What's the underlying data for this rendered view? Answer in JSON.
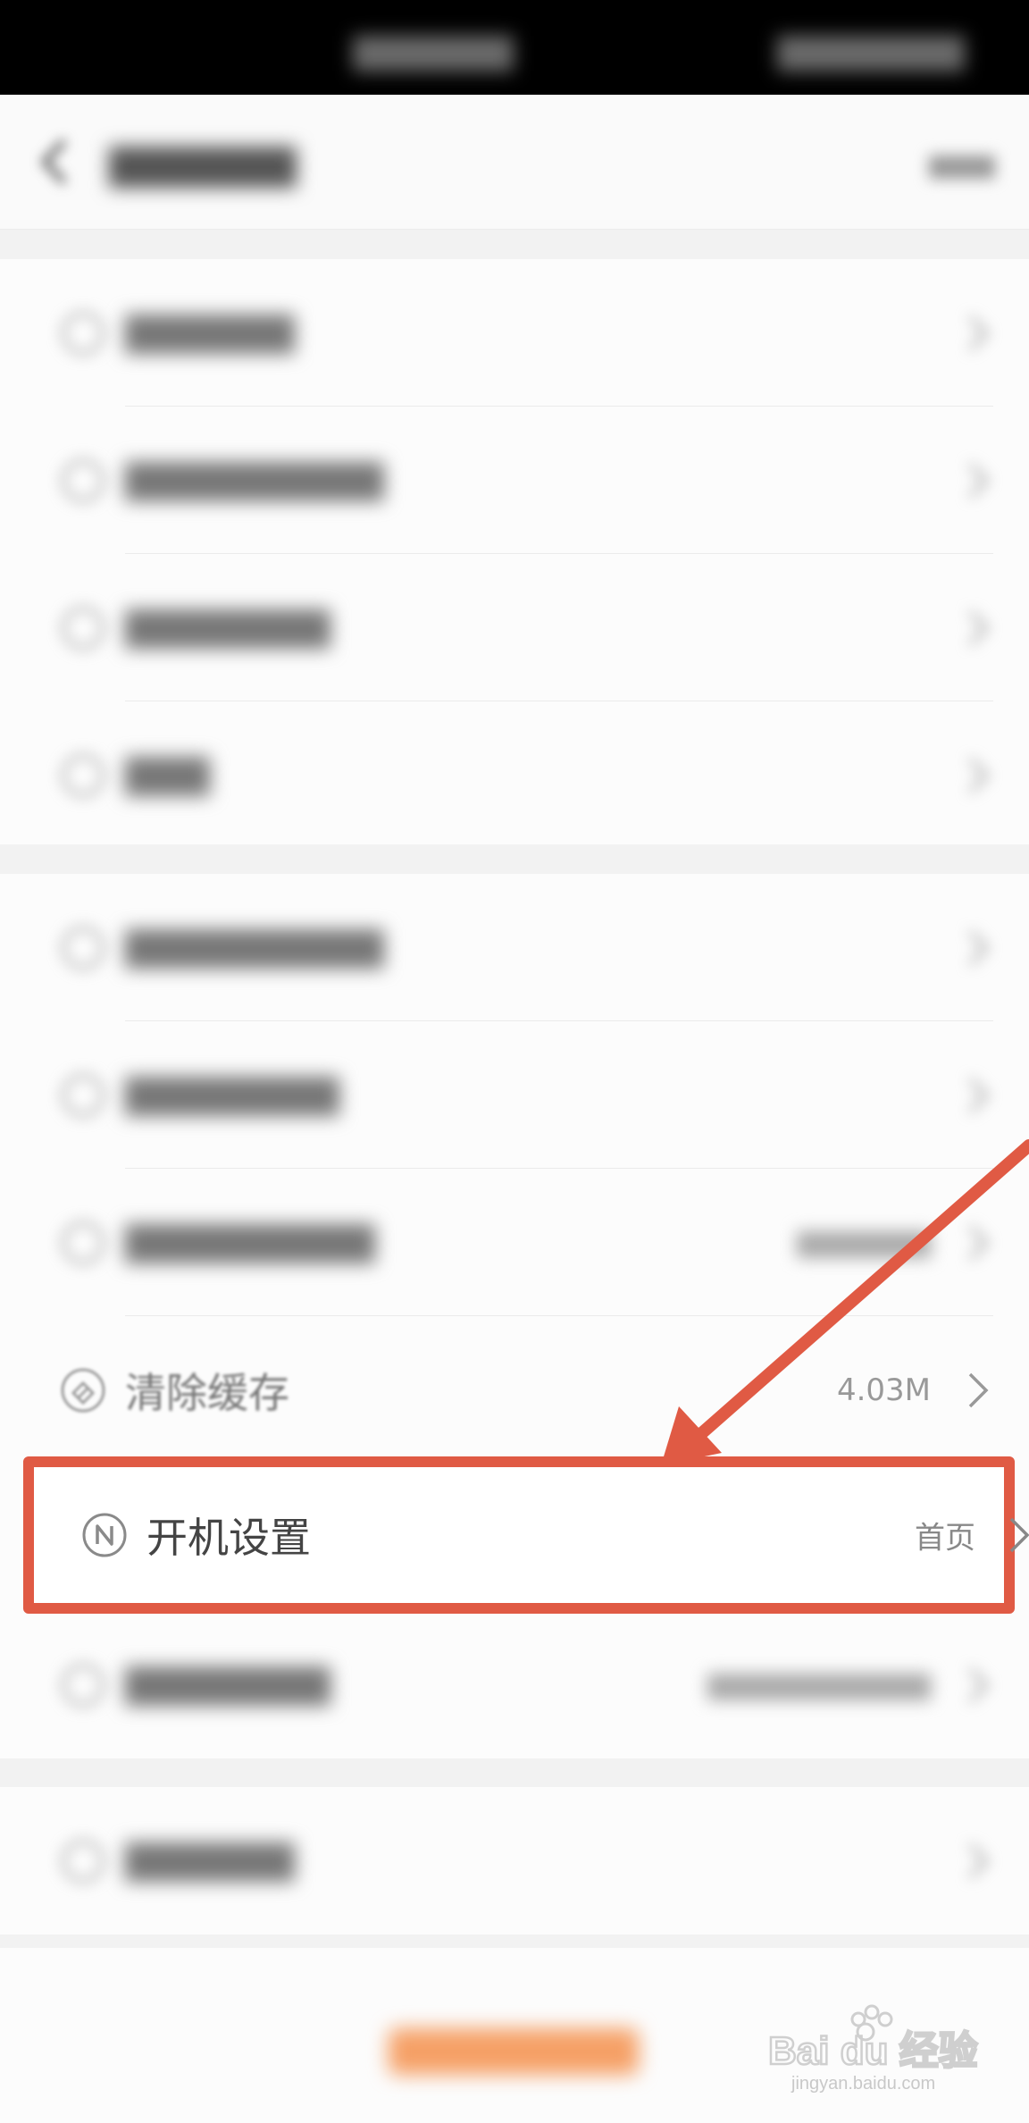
{
  "status_bar": {
    "center_text": "",
    "right_text": ""
  },
  "nav": {
    "title": "",
    "help": ""
  },
  "settings": {
    "clear_cache": {
      "label": "清除缓存",
      "value": "4.03M"
    },
    "startup": {
      "label": "开机设置",
      "value": "首页"
    }
  },
  "colors": {
    "highlight": "#e05a44",
    "accent": "#f08a3e"
  },
  "watermark": {
    "text": "Bai du 经验",
    "url": "jingyan.baidu.com"
  }
}
